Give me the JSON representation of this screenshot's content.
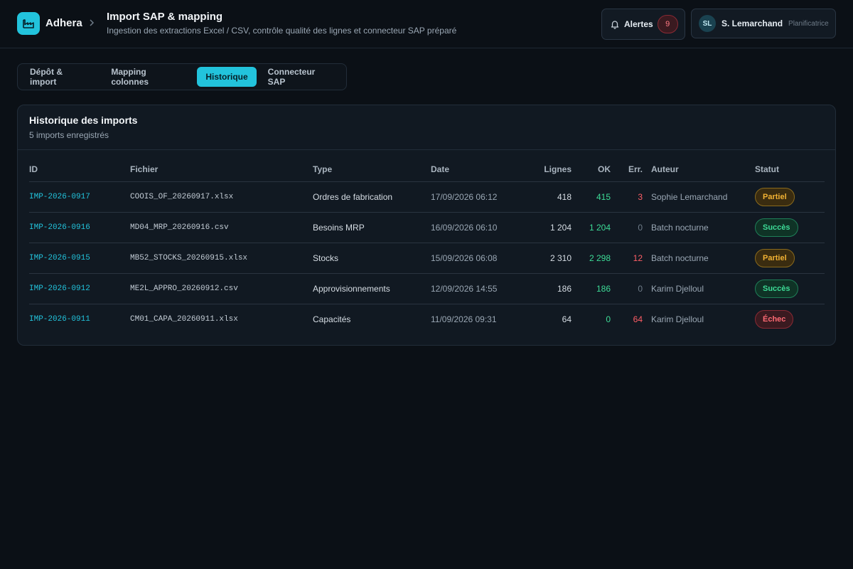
{
  "header": {
    "brand": "Adhera",
    "title": "Import SAP & mapping",
    "subtitle": "Ingestion des extractions Excel / CSV, contrôle qualité des lignes et connecteur SAP préparé",
    "alerts_label": "Alertes",
    "alerts_count": "9",
    "user_initials": "SL",
    "user_name": "S. Lemarchand",
    "user_role": "Planificatrice"
  },
  "tabs": [
    {
      "label": "Dépôt & import"
    },
    {
      "label": "Mapping colonnes"
    },
    {
      "label": "Historique"
    },
    {
      "label": "Connecteur SAP"
    }
  ],
  "history": {
    "title": "Historique des imports",
    "subtitle": "5 imports enregistrés",
    "columns": {
      "id": "ID",
      "file": "Fichier",
      "type": "Type",
      "date": "Date",
      "lines": "Lignes",
      "ok": "OK",
      "err": "Err.",
      "author": "Auteur",
      "status": "Statut"
    },
    "rows": [
      {
        "id": "IMP-2026-0917",
        "file": "COOIS_OF_20260917.xlsx",
        "type": "Ordres de fabrication",
        "date": "17/09/2026 06:12",
        "lines": "418",
        "ok": "415",
        "err": "3",
        "author": "Sophie Lemarchand",
        "status": "Partiel"
      },
      {
        "id": "IMP-2026-0916",
        "file": "MD04_MRP_20260916.csv",
        "type": "Besoins MRP",
        "date": "16/09/2026 06:10",
        "lines": "1 204",
        "ok": "1 204",
        "err": "0",
        "author": "Batch nocturne",
        "status": "Succès"
      },
      {
        "id": "IMP-2026-0915",
        "file": "MB52_STOCKS_20260915.xlsx",
        "type": "Stocks",
        "date": "15/09/2026 06:08",
        "lines": "2 310",
        "ok": "2 298",
        "err": "12",
        "author": "Batch nocturne",
        "status": "Partiel"
      },
      {
        "id": "IMP-2026-0912",
        "file": "ME2L_APPRO_20260912.csv",
        "type": "Approvisionnements",
        "date": "12/09/2026 14:55",
        "lines": "186",
        "ok": "186",
        "err": "0",
        "author": "Karim Djelloul",
        "status": "Succès"
      },
      {
        "id": "IMP-2026-0911",
        "file": "CM01_CAPA_20260911.xlsx",
        "type": "Capacités",
        "date": "11/09/2026 09:31",
        "lines": "64",
        "ok": "0",
        "err": "64",
        "author": "Karim Djelloul",
        "status": "Échec"
      }
    ]
  },
  "colors": {
    "accent": "#22c3dc",
    "success": "#3ddc97",
    "warning": "#f2b233",
    "danger": "#ff5e66"
  }
}
